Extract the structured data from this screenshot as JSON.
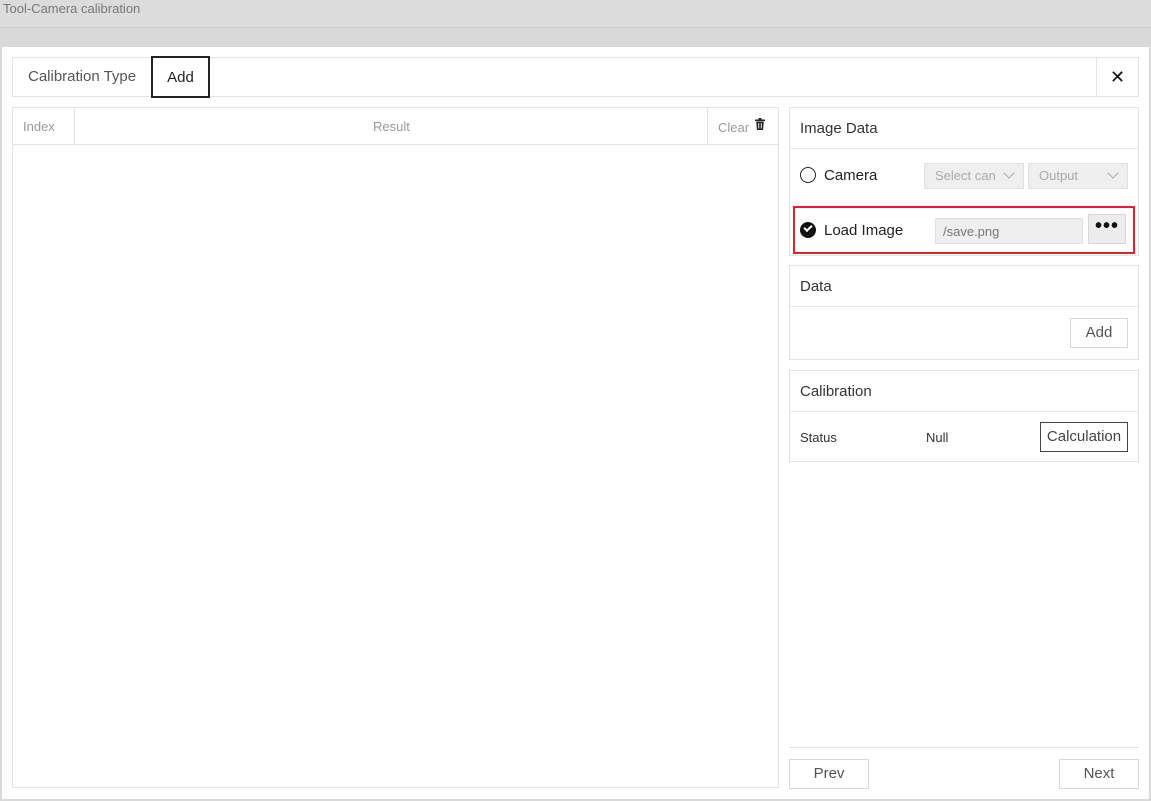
{
  "window": {
    "title": "Tool-Camera calibration"
  },
  "tabs": {
    "calibration_type": "Calibration Type",
    "add": "Add"
  },
  "close_label": "✕",
  "table": {
    "headers": {
      "index": "Index",
      "result": "Result",
      "clear": "Clear"
    },
    "rows": []
  },
  "image_data": {
    "title": "Image Data",
    "camera_label": "Camera",
    "camera_select": "Select can",
    "output_select": "Output",
    "load_image_label": "Load Image",
    "load_image_path": "/save.png",
    "browse_label": "•••",
    "selected_source": "Load Image"
  },
  "data_panel": {
    "title": "Data",
    "add_label": "Add"
  },
  "calibration": {
    "title": "Calibration",
    "status_label": "Status",
    "status_value": "Null",
    "calculate_label": "Calculation"
  },
  "footer": {
    "prev": "Prev",
    "next": "Next"
  },
  "colors": {
    "highlight": "#d7262d",
    "border": "#e3e3e3"
  }
}
